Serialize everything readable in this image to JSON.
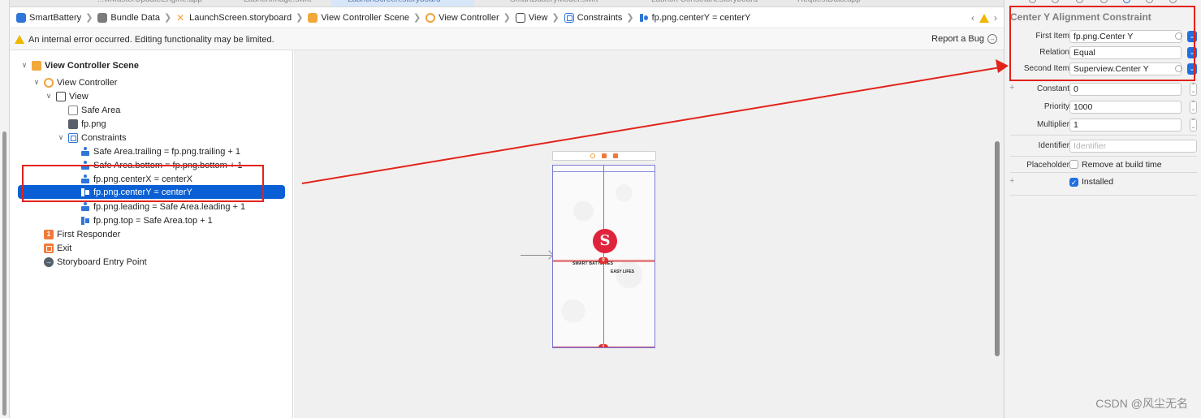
{
  "tabs": {
    "fragments": [
      "...wMasterUpdateEngine.app",
      "LaunchImage.swift",
      "LaunchScreen.storyboard",
      "SmartBatteryModel.swift",
      "Launch Constraint.storyboard",
      "RequestData.app"
    ]
  },
  "jumpbar": {
    "crumbs": [
      "SmartBattery",
      "Bundle Data",
      "LaunchScreen.storyboard",
      "View Controller Scene",
      "View Controller",
      "View",
      "Constraints",
      "fp.png.centerY = centerY"
    ]
  },
  "errorbar": {
    "message": "An internal error occurred. Editing functionality may be limited.",
    "report_label": "Report a Bug"
  },
  "outline": {
    "scene": "View Controller Scene",
    "view_controller": "View Controller",
    "view": "View",
    "safe_area": "Safe Area",
    "image": "fp.png",
    "constraints_group": "Constraints",
    "constraints": [
      "Safe Area.trailing = fp.png.trailing + 1",
      "Safe Area.bottom = fp.png.bottom + 1",
      "fp.png.centerX = centerX",
      "fp.png.centerY = centerY",
      "fp.png.leading = Safe Area.leading + 1",
      "fp.png.top = Safe Area.top + 1"
    ],
    "first_responder": "First Responder",
    "first_responder_badge": "1",
    "exit": "Exit",
    "entry_point": "Storyboard Entry Point"
  },
  "canvas": {
    "brand_line1": "SMART BATTERIES",
    "brand_line2": "EASY LIFES",
    "logo_glyph": "S",
    "badge_center": "0",
    "badge_bottom": "1"
  },
  "inspector": {
    "title": "Center Y Alignment Constraint",
    "first_item_label": "First Item",
    "first_item_value": "fp.png.Center Y",
    "relation_label": "Relation",
    "relation_value": "Equal",
    "second_item_label": "Second Item",
    "second_item_value": "Superview.Center Y",
    "constant_label": "Constant",
    "constant_value": "0",
    "priority_label": "Priority",
    "priority_value": "1000",
    "multiplier_label": "Multiplier",
    "multiplier_value": "1",
    "identifier_label": "Identifier",
    "identifier_placeholder": "Identifier",
    "placeholder_label": "Placeholder",
    "remove_label": "Remove at build time",
    "installed_label": "Installed"
  },
  "watermark": "CSDN @风尘无名",
  "colors": {
    "selection": "#0a5fd5",
    "annotation_red": "#e2231a",
    "warning": "#f2b600"
  }
}
